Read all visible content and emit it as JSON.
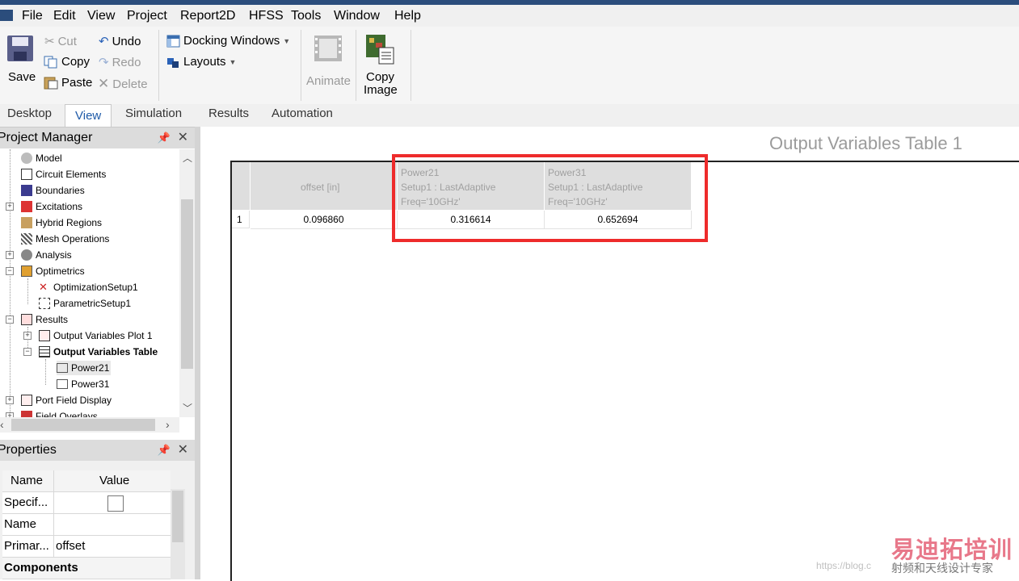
{
  "menu": [
    "File",
    "Edit",
    "View",
    "Project",
    "Report2D",
    "HFSS",
    "Tools",
    "Window",
    "Help"
  ],
  "ribbon": {
    "save": "Save",
    "cut": "Cut",
    "copy": "Copy",
    "paste": "Paste",
    "undo": "Undo",
    "redo": "Redo",
    "delete": "Delete",
    "docking": "Docking Windows",
    "layouts": "Layouts",
    "animate": "Animate",
    "copy_image_1": "Copy",
    "copy_image_2": "Image"
  },
  "tabs": [
    "Desktop",
    "View",
    "Simulation",
    "Results",
    "Automation"
  ],
  "project_manager": {
    "title": "Project Manager",
    "items": {
      "model": "Model",
      "circuit": "Circuit Elements",
      "boundaries": "Boundaries",
      "excitations": "Excitations",
      "hybrid": "Hybrid Regions",
      "mesh": "Mesh Operations",
      "analysis": "Analysis",
      "optimetrics": "Optimetrics",
      "opt_setup": "OptimizationSetup1",
      "param_setup": "ParametricSetup1",
      "results": "Results",
      "ov_plot": "Output Variables Plot 1",
      "ov_table": "Output Variables Table",
      "power21": "Power21",
      "power31": "Power31",
      "port_field": "Port Field Display",
      "field_overlays": "Field Overlays"
    }
  },
  "properties": {
    "title": "Properties",
    "col_name": "Name",
    "col_value": "Value",
    "rows": [
      {
        "name": "Specif...",
        "value": ""
      },
      {
        "name": "Name",
        "value": ""
      },
      {
        "name": "Primar...",
        "value": "offset"
      }
    ],
    "section": "Components"
  },
  "table": {
    "title": "Output Variables Table 1",
    "col1_header": "offset [in]",
    "col2_header": [
      "Power21",
      "Setup1 : LastAdaptive",
      "Freq='10GHz'"
    ],
    "col3_header": [
      "Power31",
      "Setup1 : LastAdaptive",
      "Freq='10GHz'"
    ],
    "row_index": "1",
    "offset": "0.096860",
    "power21": "0.316614",
    "power31": "0.652694"
  },
  "watermark": {
    "cn_title": "易迪拓培训",
    "cn_sub": "射频和天线设计专家",
    "url": "https://blog.c"
  },
  "colors": {
    "highlight": "#ee2b2b",
    "header_bg": "#dedede",
    "selected_row": "#e8e8e8"
  }
}
